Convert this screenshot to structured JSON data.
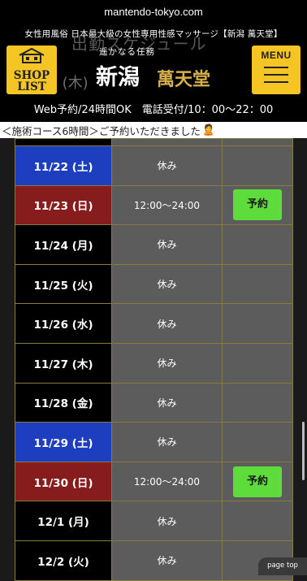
{
  "browser": {
    "url": "mantendo-tokyo.com"
  },
  "header": {
    "tagline": "女性用風俗 日本最大級の女性専用性感マッサージ【新潟 萬天堂】",
    "ghost_title": "出勤スケジュール",
    "ghost_row": "20 (木)",
    "shop_list_label": [
      "SHOP",
      "LIST"
    ],
    "logo_sub": "遥かなる任務",
    "logo_main": "新潟",
    "logo_gold": "萬天堂",
    "menu_label": "MENU",
    "contact": "Web予約/24時間OK　電話受付/10：00～22：00"
  },
  "notice": {
    "text": "＜施術コース6時間＞ご予約いただきました",
    "icon": "person-face-icon"
  },
  "schedule": {
    "rows": [
      {
        "date": "11/22 (土)",
        "day_type": "sat",
        "time": "休み",
        "reserve": ""
      },
      {
        "date": "11/23 (日)",
        "day_type": "sun",
        "time": "12:00～24:00",
        "reserve": "予約"
      },
      {
        "date": "11/24 (月)",
        "day_type": "weekday",
        "time": "休み",
        "reserve": ""
      },
      {
        "date": "11/25 (火)",
        "day_type": "weekday",
        "time": "休み",
        "reserve": ""
      },
      {
        "date": "11/26 (水)",
        "day_type": "weekday",
        "time": "休み",
        "reserve": ""
      },
      {
        "date": "11/27 (木)",
        "day_type": "weekday",
        "time": "休み",
        "reserve": ""
      },
      {
        "date": "11/28 (金)",
        "day_type": "weekday",
        "time": "休み",
        "reserve": ""
      },
      {
        "date": "11/29 (土)",
        "day_type": "sat",
        "time": "休み",
        "reserve": ""
      },
      {
        "date": "11/30 (日)",
        "day_type": "sun",
        "time": "12:00～24:00",
        "reserve": "予約"
      },
      {
        "date": "12/1 (月)",
        "day_type": "weekday",
        "time": "休み",
        "reserve": ""
      },
      {
        "date": "12/2 (火)",
        "day_type": "weekday",
        "time": "休み",
        "reserve": ""
      }
    ]
  },
  "page_top_label": "page top",
  "colors": {
    "accent_yellow": "#f5c524",
    "sat_blue": "#1c3ebf",
    "sun_red": "#871c1c",
    "reserve_green": "#5ddc3b",
    "gold": "#d8b04a"
  }
}
